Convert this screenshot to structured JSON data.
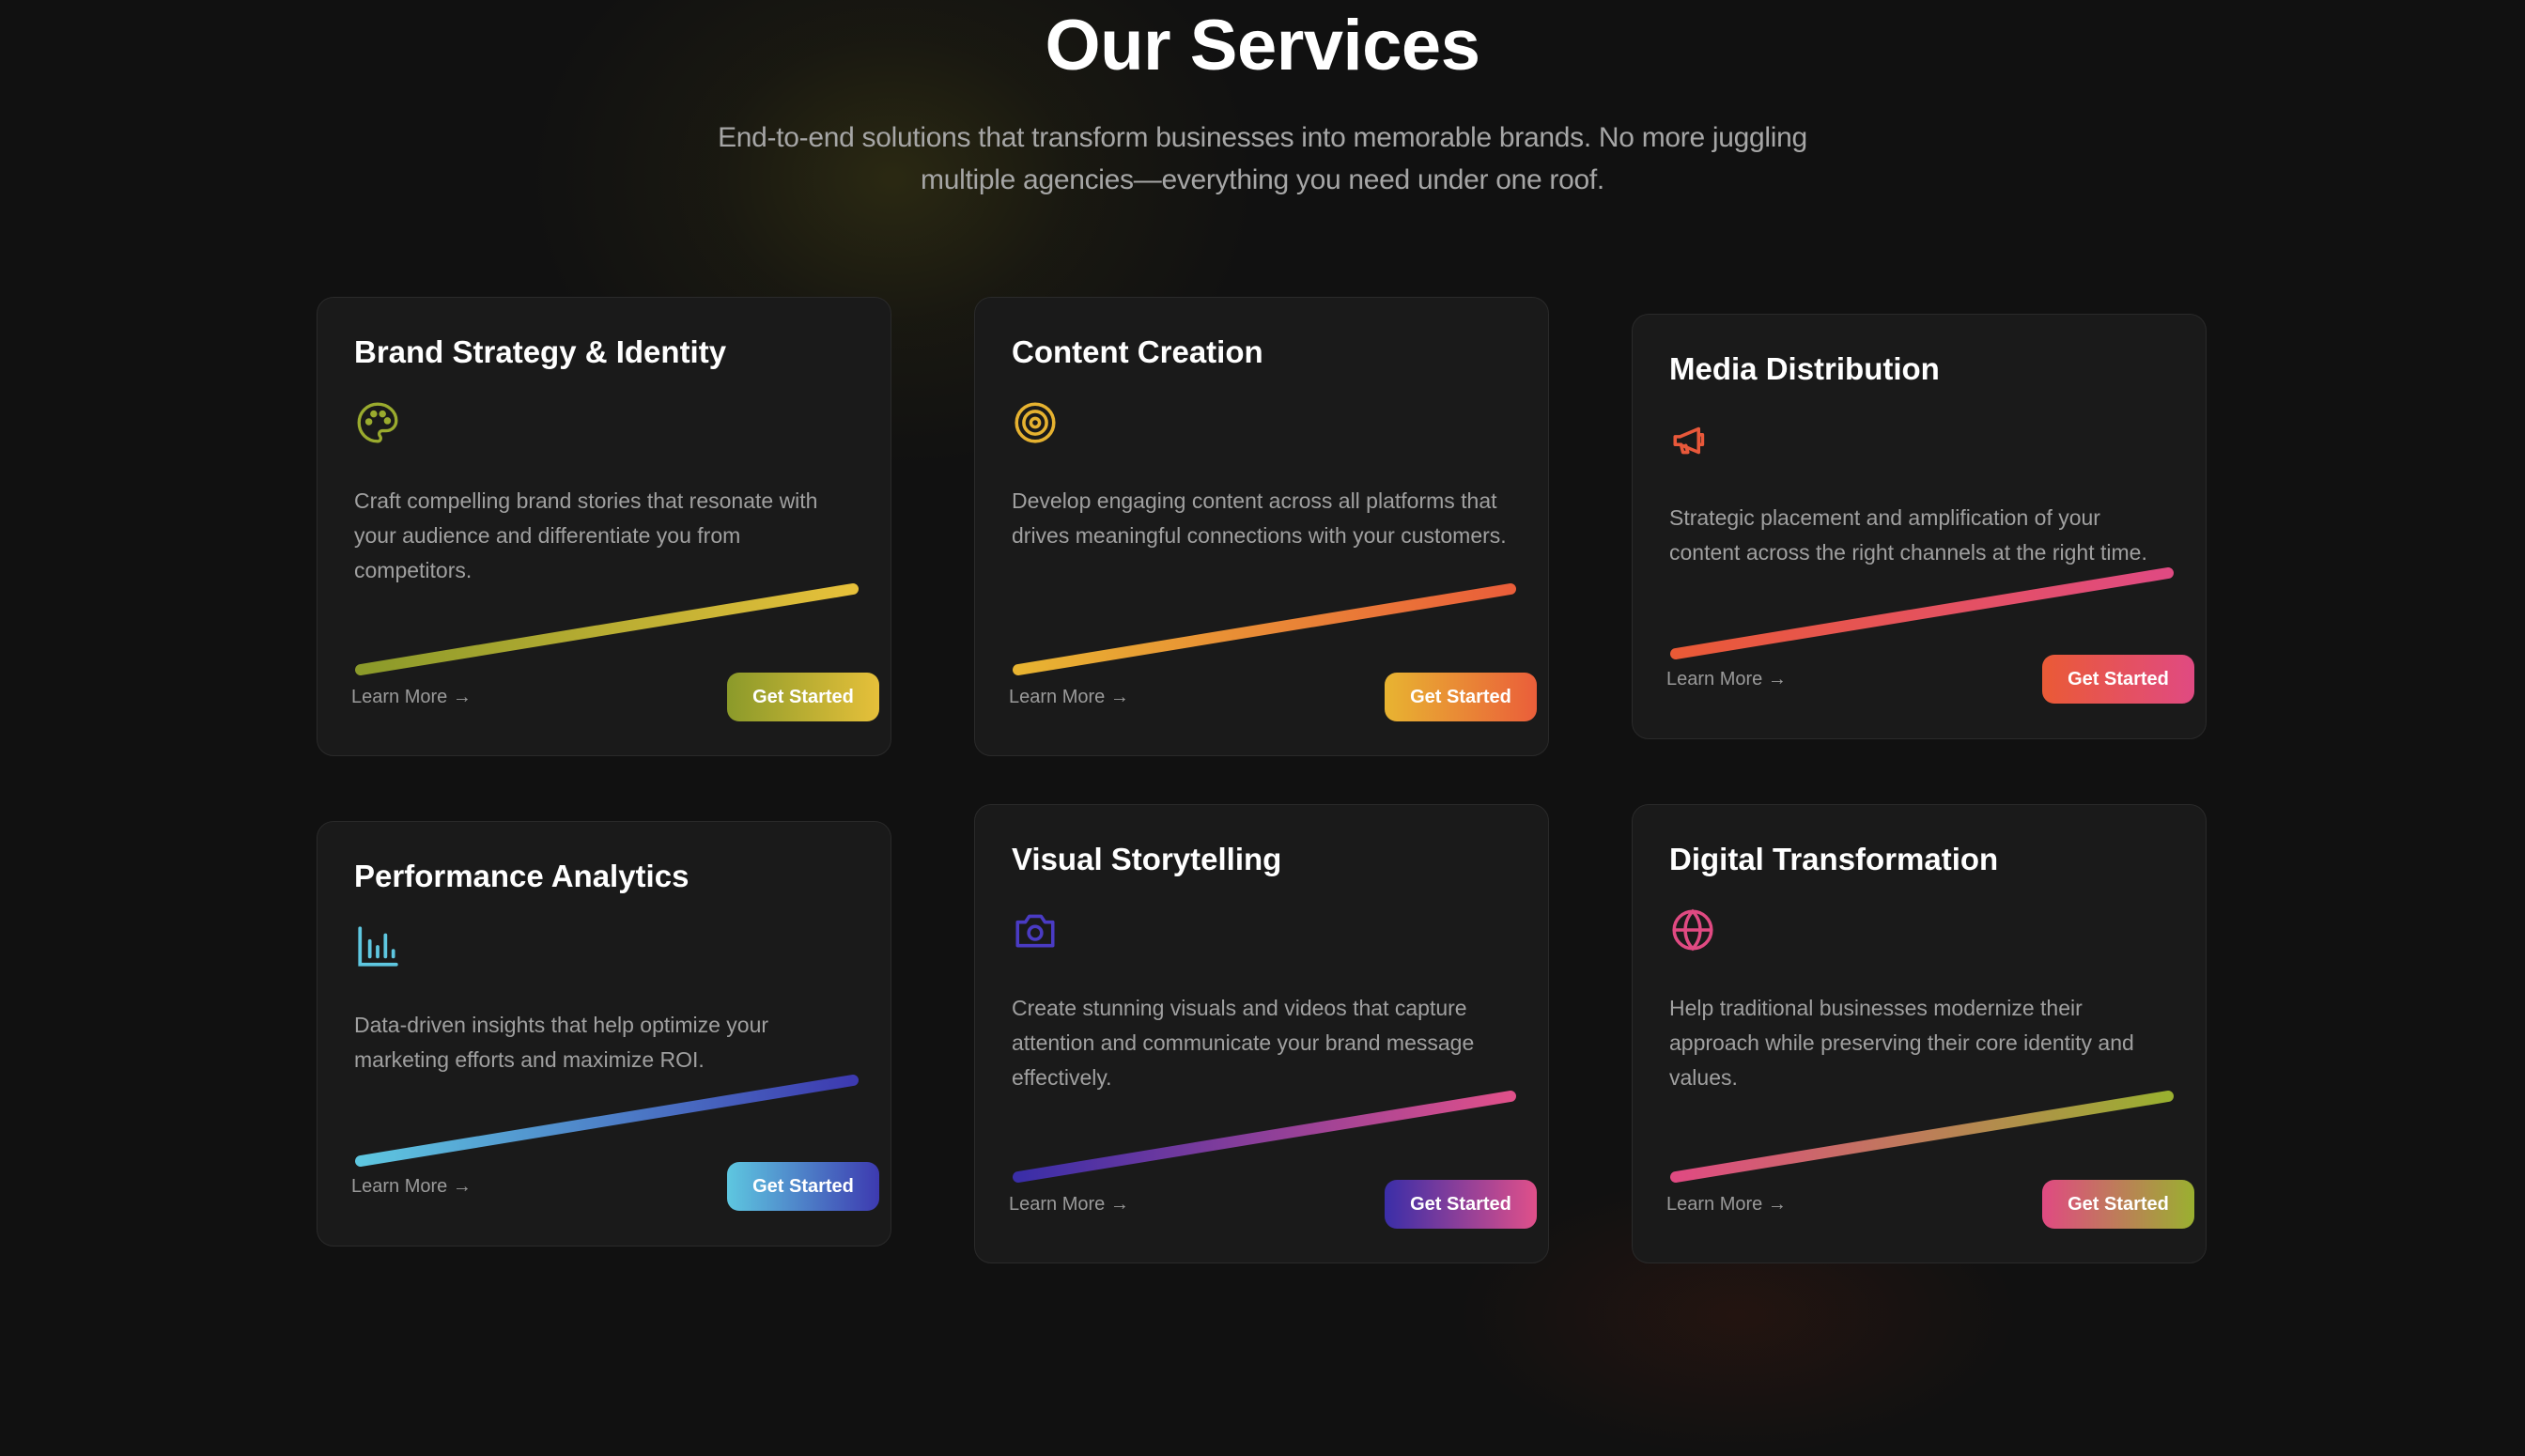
{
  "header": {
    "title": "Our Services",
    "subtitle": "End-to-end solutions that transform businesses into memorable brands. No more juggling multiple agencies—everything you need under one roof."
  },
  "cards": [
    {
      "title": "Brand Strategy & Identity",
      "icon": "palette-icon",
      "description": "Craft compelling brand stories that resonate with your audience and differentiate you from competitors.",
      "learn_more": "Learn More →",
      "button": "Get Started",
      "accent_start": "#8b9a2a",
      "accent_end": "#e6c03a"
    },
    {
      "title": "Content Creation",
      "icon": "target-icon",
      "description": "Develop engaging content across all platforms that drives meaningful connections with your customers.",
      "learn_more": "Learn More →",
      "button": "Get Started",
      "accent_start": "#e8b431",
      "accent_end": "#ea5e3a"
    },
    {
      "title": "Media Distribution",
      "icon": "megaphone-icon",
      "description": "Strategic placement and amplification of your content across the right channels at the right time.",
      "learn_more": "Learn More →",
      "button": "Get Started",
      "accent_start": "#ea5a36",
      "accent_end": "#e04a82"
    },
    {
      "title": "Performance Analytics",
      "icon": "bar-chart-icon",
      "description": "Data-driven insights that help optimize your marketing efforts and maximize ROI.",
      "learn_more": "Learn More →",
      "button": "Get Started",
      "accent_start": "#5ec7e0",
      "accent_end": "#3d3ab0"
    },
    {
      "title": "Visual Storytelling",
      "icon": "camera-icon",
      "description": "Create stunning visuals and videos that capture attention and communicate your brand message effectively.",
      "learn_more": "Learn More →",
      "button": "Get Started",
      "accent_start": "#3a2ea8",
      "accent_end": "#e0508a"
    },
    {
      "title": "Digital Transformation",
      "icon": "globe-icon",
      "description": "Help traditional businesses modernize their approach while preserving their core identity and values.",
      "learn_more": "Learn More →",
      "button": "Get Started",
      "accent_start": "#e04a82",
      "accent_end": "#9ab030"
    }
  ]
}
